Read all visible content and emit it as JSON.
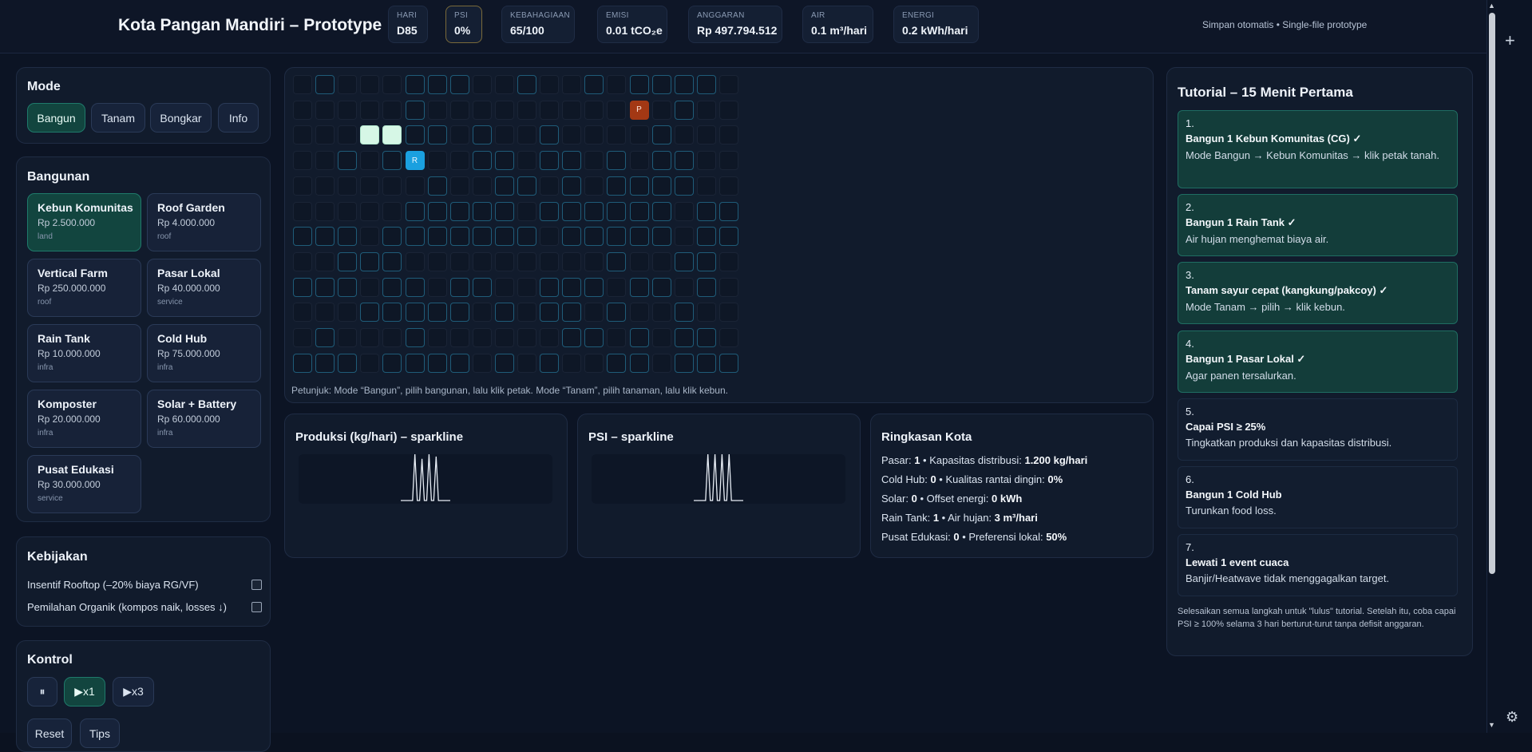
{
  "header": {
    "title": "Kota Pangan Mandiri – Prototype",
    "stats": [
      {
        "label": "HARI",
        "value": "D85"
      },
      {
        "label": "PSI",
        "value": "0%"
      },
      {
        "label": "KEBAHAGIAAN",
        "value": "65/100"
      },
      {
        "label": "EMISI",
        "value": "0.01 tCO₂e"
      },
      {
        "label": "ANGGARAN",
        "value": "Rp 497.794.512"
      },
      {
        "label": "AIR",
        "value": "0.1 m³/hari"
      },
      {
        "label": "ENERGI",
        "value": "0.2 kWh/hari"
      }
    ],
    "autosave": "Simpan otomatis • Single-file prototype"
  },
  "mode": {
    "title": "Mode",
    "buttons": [
      "Bangun",
      "Tanam",
      "Bongkar",
      "Info"
    ],
    "active": "Bangun"
  },
  "buildings": {
    "title": "Bangunan",
    "items": [
      {
        "name": "Kebun Komunitas",
        "cost": "Rp 2.500.000",
        "category": "land"
      },
      {
        "name": "Roof Garden",
        "cost": "Rp 4.000.000",
        "category": "roof"
      },
      {
        "name": "Vertical Farm",
        "cost": "Rp 250.000.000",
        "category": "roof"
      },
      {
        "name": "Pasar Lokal",
        "cost": "Rp 40.000.000",
        "category": "service"
      },
      {
        "name": "Rain Tank",
        "cost": "Rp 10.000.000",
        "category": "infra"
      },
      {
        "name": "Cold Hub",
        "cost": "Rp 75.000.000",
        "category": "infra"
      },
      {
        "name": "Komposter",
        "cost": "Rp 20.000.000",
        "category": "infra"
      },
      {
        "name": "Solar + Battery",
        "cost": "Rp 60.000.000",
        "category": "infra"
      },
      {
        "name": "Pusat Edukasi",
        "cost": "Rp 30.000.000",
        "category": "service"
      }
    ],
    "selected": "Kebun Komunitas"
  },
  "policy": {
    "title": "Kebijakan",
    "items": [
      {
        "label": "Insentif Rooftop (–20% biaya RG/VF)",
        "checked": false
      },
      {
        "label": "Pemilahan Organik (kompos naik, losses ↓)",
        "checked": false
      }
    ]
  },
  "control": {
    "title": "Kontrol",
    "pause": "⏸",
    "speed1": "▶x1",
    "speed3": "▶x3",
    "reset": "Reset",
    "tips": "Tips"
  },
  "map": {
    "hint": "Petunjuk: Mode “Bangun”, pilih bangunan, lalu klik petak. Mode “Tanam”, pilih tanaman, lalu klik kebun.",
    "tank_label": "R",
    "market_label": "P"
  },
  "production": {
    "title": "Produksi (kg/hari) – sparkline",
    "values": [
      0,
      0,
      0,
      0,
      0,
      0,
      1,
      0,
      0,
      0.9,
      0,
      0,
      1,
      0,
      0,
      0.95,
      0,
      0,
      0,
      0,
      0,
      0
    ]
  },
  "psi": {
    "title": "PSI – sparkline",
    "values": [
      0,
      0,
      0,
      0,
      0,
      0,
      1,
      0,
      0,
      1,
      0,
      0,
      1,
      0,
      0,
      1,
      0,
      0,
      0,
      0,
      0,
      0
    ]
  },
  "summary": {
    "title": "Ringkasan Kota",
    "lines": [
      {
        "k1": "Pasar:",
        "v1": "1",
        "k2": "Kapasitas distribusi:",
        "v2": "1.200 kg/hari"
      },
      {
        "k1": "Cold Hub:",
        "v1": "0",
        "k2": "Kualitas rantai dingin:",
        "v2": "0%"
      },
      {
        "k1": "Solar:",
        "v1": "0",
        "k2": "Offset energi:",
        "v2": "0 kWh"
      },
      {
        "k1": "Rain Tank:",
        "v1": "1",
        "k2": "Air hujan:",
        "v2": "3 m³/hari"
      },
      {
        "k1": "Pusat Edukasi:",
        "v1": "0",
        "k2": "Preferensi lokal:",
        "v2": "50%"
      }
    ]
  },
  "tutorial": {
    "title": "Tutorial – 15 Menit Pertama",
    "steps": [
      {
        "num": "1.",
        "title": "Bangun 1 Kebun Komunitas (CG) ✓",
        "desc": "Mode Bangun → Kebun Komunitas → klik petak tanah.",
        "done": true
      },
      {
        "num": "2.",
        "title": "Bangun 1 Rain Tank ✓",
        "desc": "Air hujan menghemat biaya air.",
        "done": true
      },
      {
        "num": "3.",
        "title": "Tanam sayur cepat (kangkung/pakcoy) ✓",
        "desc": "Mode Tanam → pilih → klik kebun.",
        "done": true
      },
      {
        "num": "4.",
        "title": "Bangun 1 Pasar Lokal ✓",
        "desc": "Agar panen tersalurkan.",
        "done": true
      },
      {
        "num": "5.",
        "title": "Capai PSI ≥ 25%",
        "desc": "Tingkatkan produksi dan kapasitas distribusi.",
        "done": false
      },
      {
        "num": "6.",
        "title": "Bangun 1 Cold Hub",
        "desc": "Turunkan food loss.",
        "done": false
      },
      {
        "num": "7.",
        "title": "Lewati 1 event cuaca",
        "desc": "Banjir/Heatwave tidak menggagalkan target.",
        "done": false
      }
    ],
    "footer": "Selesaikan semua langkah untuk \"lulus\" tutorial. Setelah itu, coba capai PSI ≥ 100% selama 3 hari berturut-turut tanpa defisit anggaran."
  },
  "icons": {
    "plus": "plus-icon",
    "gear": "gear-icon"
  }
}
